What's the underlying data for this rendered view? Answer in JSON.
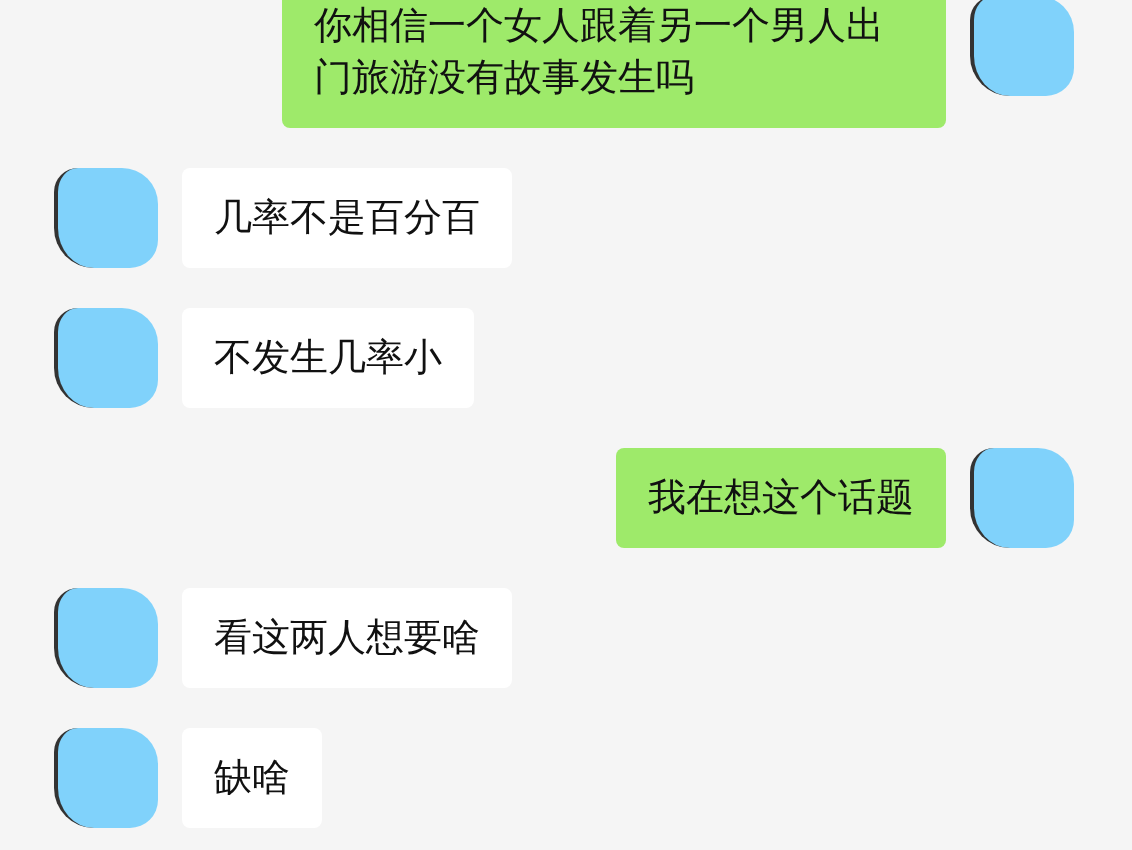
{
  "messages": [
    {
      "kind": "outgoing",
      "text": "你相信一个女人跟着另一个男人出门旅游没有故事发生吗"
    },
    {
      "kind": "incoming",
      "text": "几率不是百分百"
    },
    {
      "kind": "incoming",
      "text": "不发生几率小"
    },
    {
      "kind": "outgoing",
      "text": "我在想这个话题"
    },
    {
      "kind": "incoming",
      "text": "看这两人想要啥"
    },
    {
      "kind": "incoming",
      "text": "缺啥"
    }
  ]
}
